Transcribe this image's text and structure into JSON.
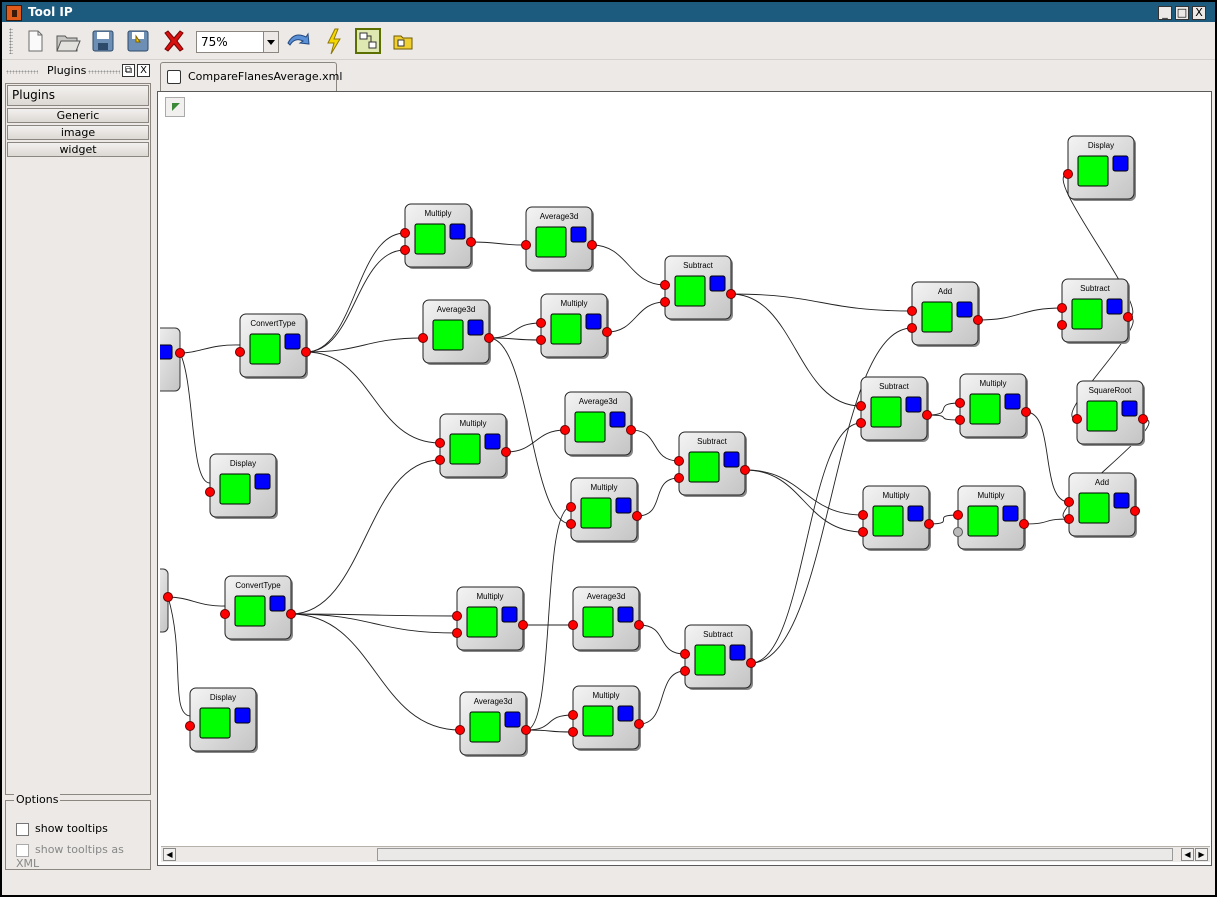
{
  "window": {
    "title": "Tool IP",
    "app_icon": "app-icon",
    "minimize": "_",
    "maximize": "□",
    "close": "X"
  },
  "toolbar": {
    "new": "new-document-icon",
    "open": "open-folder-icon",
    "save": "save-icon",
    "save_as": "save-as-icon",
    "delete": "delete-icon",
    "zoom_value": "75%",
    "undo": "undo-icon",
    "run": "lightning-icon",
    "graph_mode": "graph-mode-icon",
    "load_plugins": "load-plugins-icon"
  },
  "dock": {
    "title": "Plugins",
    "float": "⧉",
    "close": "X"
  },
  "plugins": {
    "header": "Plugins",
    "categories": [
      "Generic",
      "image",
      "widget"
    ]
  },
  "options": {
    "legend": "Options",
    "show_tooltips": "show tooltips",
    "show_tooltips_xml": "show tooltips as XML"
  },
  "tab": {
    "label": "CompareFlanesAverage.xml"
  },
  "colors": {
    "node_output": "#00ff00",
    "node_param": "#0000ff",
    "port": "#ff0000",
    "titlebar": "#1c5a7e"
  },
  "graph": {
    "nodes": [
      {
        "id": "n1",
        "label": "ConvertType"
      },
      {
        "id": "n2",
        "label": "Display"
      },
      {
        "id": "n3",
        "label": "ConvertType"
      },
      {
        "id": "n4",
        "label": "Display"
      },
      {
        "id": "n5",
        "label": "Multiply"
      },
      {
        "id": "n6",
        "label": "Average3d"
      },
      {
        "id": "n7",
        "label": "Average3d"
      },
      {
        "id": "n8",
        "label": "Multiply"
      },
      {
        "id": "n9",
        "label": "Subtract"
      },
      {
        "id": "n10",
        "label": "Multiply"
      },
      {
        "id": "n11",
        "label": "Average3d"
      },
      {
        "id": "n12",
        "label": "Multiply"
      },
      {
        "id": "n13",
        "label": "Subtract"
      },
      {
        "id": "n14",
        "label": "Multiply"
      },
      {
        "id": "n15",
        "label": "Average3d"
      },
      {
        "id": "n16",
        "label": "Average3d"
      },
      {
        "id": "n17",
        "label": "Multiply"
      },
      {
        "id": "n18",
        "label": "Subtract"
      },
      {
        "id": "n19",
        "label": "Add"
      },
      {
        "id": "n20",
        "label": "Subtract"
      },
      {
        "id": "n21",
        "label": "Multiply"
      },
      {
        "id": "n22",
        "label": "Multiply"
      },
      {
        "id": "n23",
        "label": "Multiply"
      },
      {
        "id": "n24",
        "label": "Display"
      },
      {
        "id": "n25",
        "label": "Subtract"
      },
      {
        "id": "n26",
        "label": "SquareRoot"
      },
      {
        "id": "n27",
        "label": "Add"
      }
    ]
  }
}
